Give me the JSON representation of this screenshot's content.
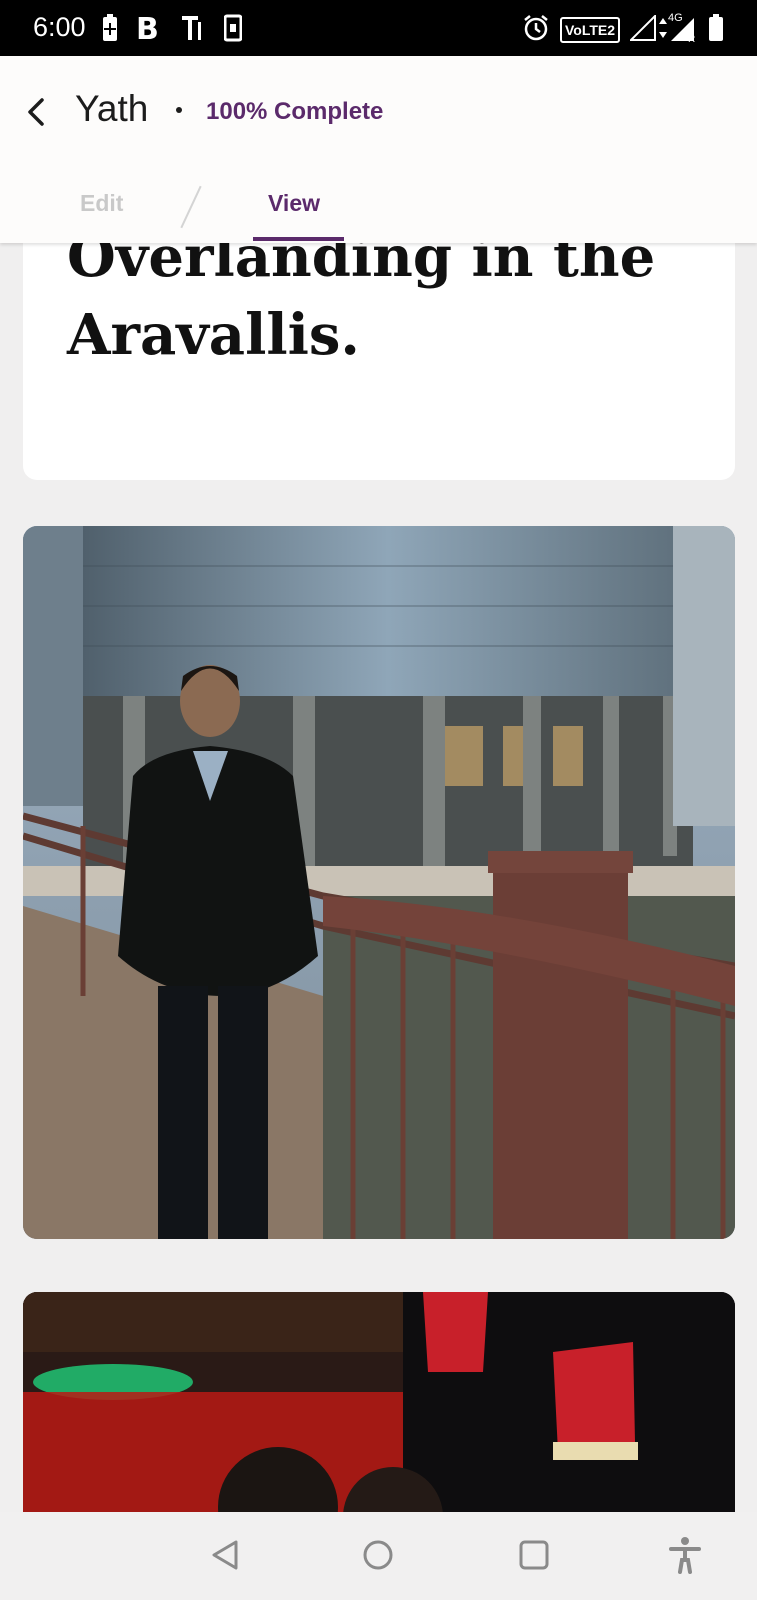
{
  "status_bar": {
    "time": "6:00",
    "network_badge": "VoLTE2",
    "network_type": "4G",
    "icons": [
      "battery-saver-icon",
      "b-notification-icon",
      "t-notification-icon",
      "sim-icon",
      "alarm-icon",
      "signal-icon",
      "data-arrows-icon",
      "battery-icon"
    ]
  },
  "header": {
    "title": "Yath",
    "progress_label": "100% Complete",
    "tabs": [
      {
        "label": "Edit",
        "active": false
      },
      {
        "label": "View",
        "active": true
      }
    ],
    "accent_color": "#5b2a6b"
  },
  "content": {
    "heading": "Overlanding in the Aravallis."
  },
  "nav_bar": {
    "icons": [
      "back-triangle-icon",
      "home-circle-icon",
      "recents-square-icon",
      "accessibility-icon"
    ]
  }
}
